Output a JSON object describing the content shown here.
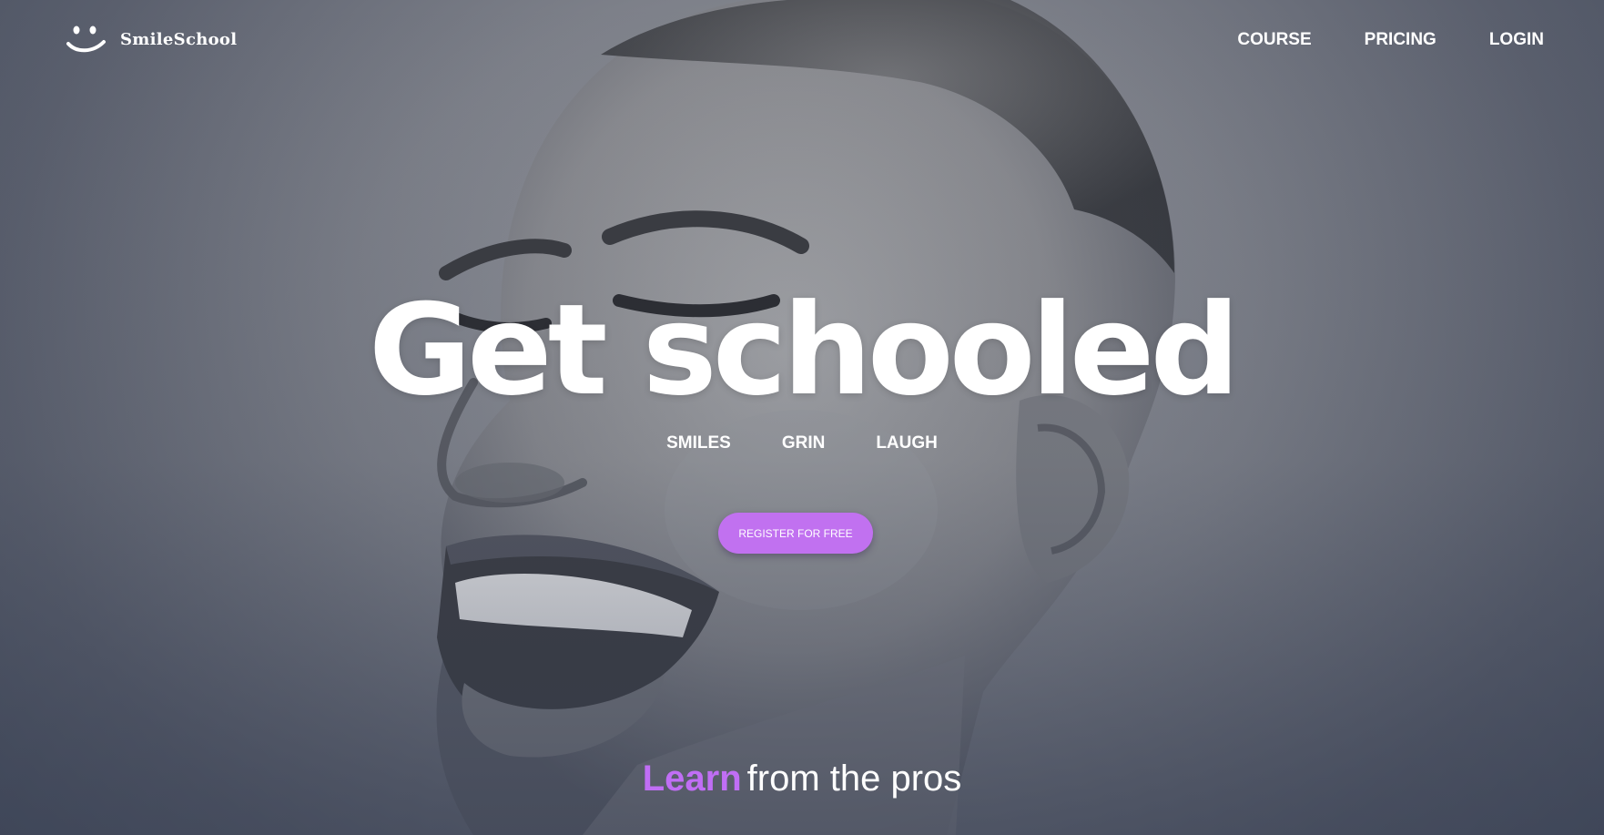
{
  "brand": {
    "name": "SmileSchool",
    "logo_icon": "smiley-face-icon"
  },
  "nav": {
    "items": [
      {
        "label": "COURSE"
      },
      {
        "label": "PRICING"
      },
      {
        "label": "LOGIN"
      }
    ]
  },
  "hero": {
    "headline": "Get schooled",
    "tags": [
      "SMILES",
      "GRIN",
      "LAUGH"
    ],
    "cta_label": "REGISTER FOR FREE",
    "subheadline_emphasis": "Learn",
    "subheadline_rest": "from the pros",
    "accent_color": "#c171f0",
    "background_image": "grayscale-portrait-smiling-woman"
  }
}
